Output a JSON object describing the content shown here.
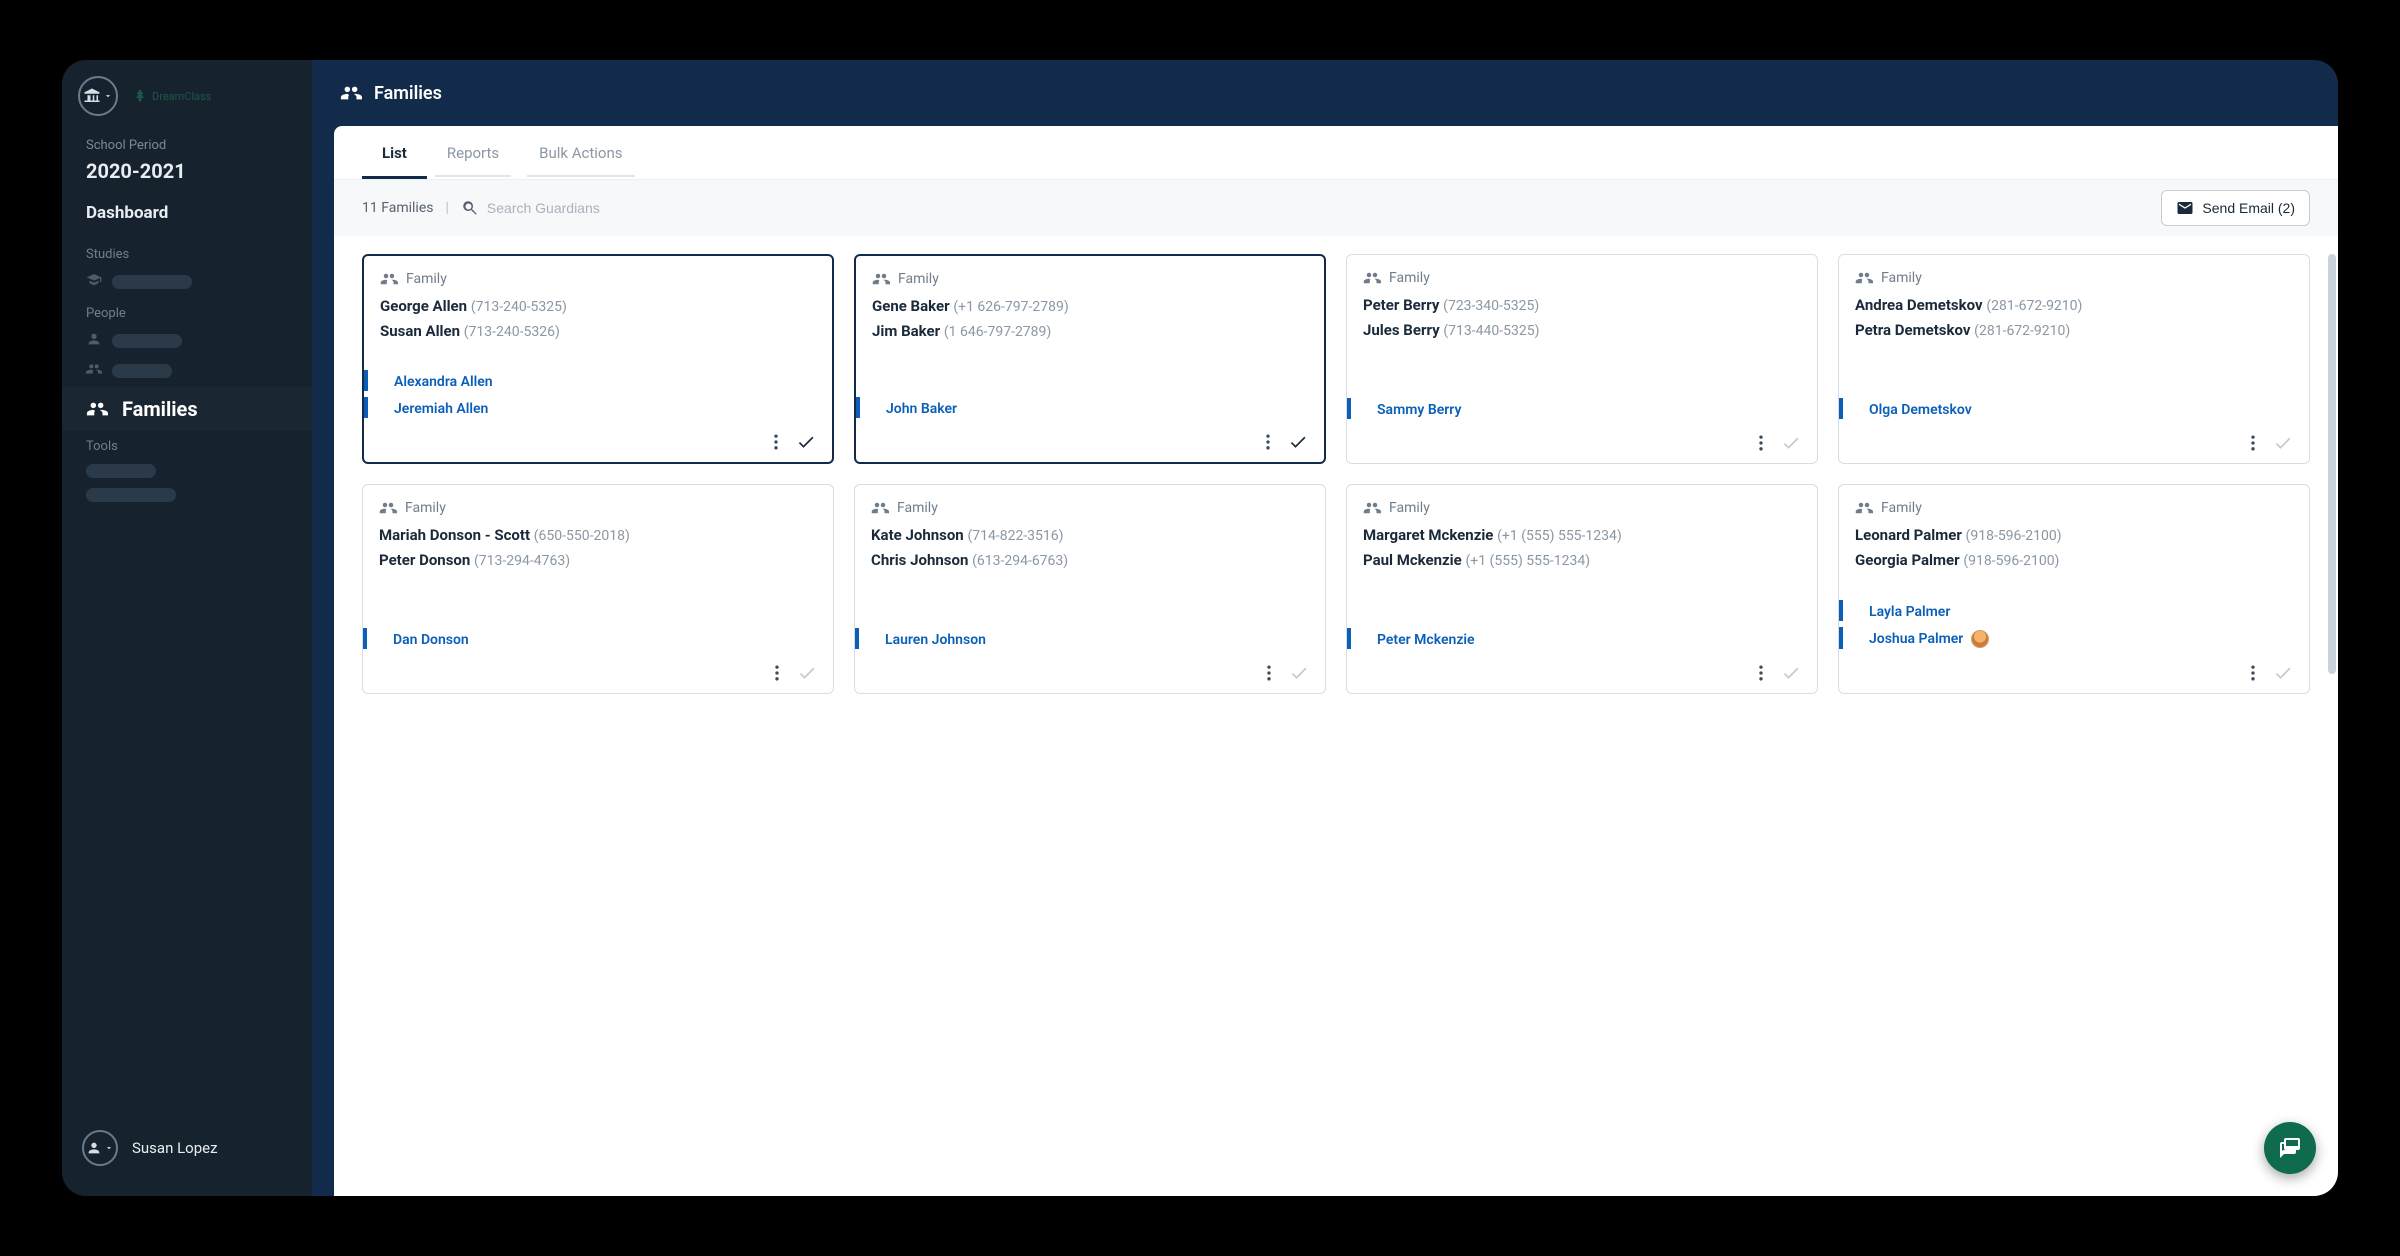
{
  "sidebar": {
    "school_period_label": "School Period",
    "school_period_value": "2020-2021",
    "dashboard_label": "Dashboard",
    "sections": {
      "studies_label": "Studies",
      "people_label": "People",
      "tools_label": "Tools"
    },
    "active_nav_label": "Families",
    "user_name": "Susan Lopez",
    "brand_name": "DreamClass"
  },
  "header": {
    "title": "Families"
  },
  "tabs": {
    "list": "List",
    "reports": "Reports",
    "bulk": "Bulk Actions"
  },
  "toolbar": {
    "count_text": "11 Families",
    "search_placeholder": "Search Guardians",
    "send_email_label": "Send Email (2)"
  },
  "card_label": "Family",
  "families": [
    {
      "selected": true,
      "guardians": [
        {
          "name": "George Allen",
          "phone": "(713-240-5325)"
        },
        {
          "name": "Susan Allen",
          "phone": "(713-240-5326)"
        }
      ],
      "children": [
        {
          "name": "Alexandra Allen"
        },
        {
          "name": "Jeremiah Allen"
        }
      ]
    },
    {
      "selected": true,
      "guardians": [
        {
          "name": "Gene Baker",
          "phone": "(+1 626-797-2789)"
        },
        {
          "name": "Jim Baker",
          "phone": "(1 646-797-2789)"
        }
      ],
      "children": [
        {
          "name": "John Baker"
        }
      ]
    },
    {
      "selected": false,
      "guardians": [
        {
          "name": "Peter Berry",
          "phone": "(723-340-5325)"
        },
        {
          "name": "Jules Berry",
          "phone": "(713-440-5325)"
        }
      ],
      "children": [
        {
          "name": "Sammy Berry"
        }
      ]
    },
    {
      "selected": false,
      "guardians": [
        {
          "name": "Andrea Demetskov",
          "phone": "(281-672-9210)"
        },
        {
          "name": "Petra Demetskov",
          "phone": "(281-672-9210)"
        }
      ],
      "children": [
        {
          "name": "Olga Demetskov"
        }
      ]
    },
    {
      "selected": false,
      "guardians": [
        {
          "name": "Mariah Donson - Scott",
          "phone": "(650-550-2018)"
        },
        {
          "name": "Peter Donson",
          "phone": "(713-294-4763)"
        }
      ],
      "children": [
        {
          "name": "Dan Donson"
        }
      ]
    },
    {
      "selected": false,
      "guardians": [
        {
          "name": "Kate Johnson",
          "phone": "(714-822-3516)"
        },
        {
          "name": "Chris Johnson",
          "phone": "(613-294-6763)"
        }
      ],
      "children": [
        {
          "name": "Lauren Johnson"
        }
      ]
    },
    {
      "selected": false,
      "guardians": [
        {
          "name": "Margaret Mckenzie",
          "phone": "(+1 (555) 555-1234)"
        },
        {
          "name": "Paul Mckenzie",
          "phone": "(+1 (555) 555-1234)"
        }
      ],
      "children": [
        {
          "name": "Peter Mckenzie"
        }
      ]
    },
    {
      "selected": false,
      "guardians": [
        {
          "name": "Leonard Palmer",
          "phone": "(918-596-2100)"
        },
        {
          "name": "Georgia Palmer",
          "phone": "(918-596-2100)"
        }
      ],
      "children": [
        {
          "name": "Layla Palmer"
        },
        {
          "name": "Joshua Palmer",
          "avatar": true
        }
      ]
    }
  ]
}
